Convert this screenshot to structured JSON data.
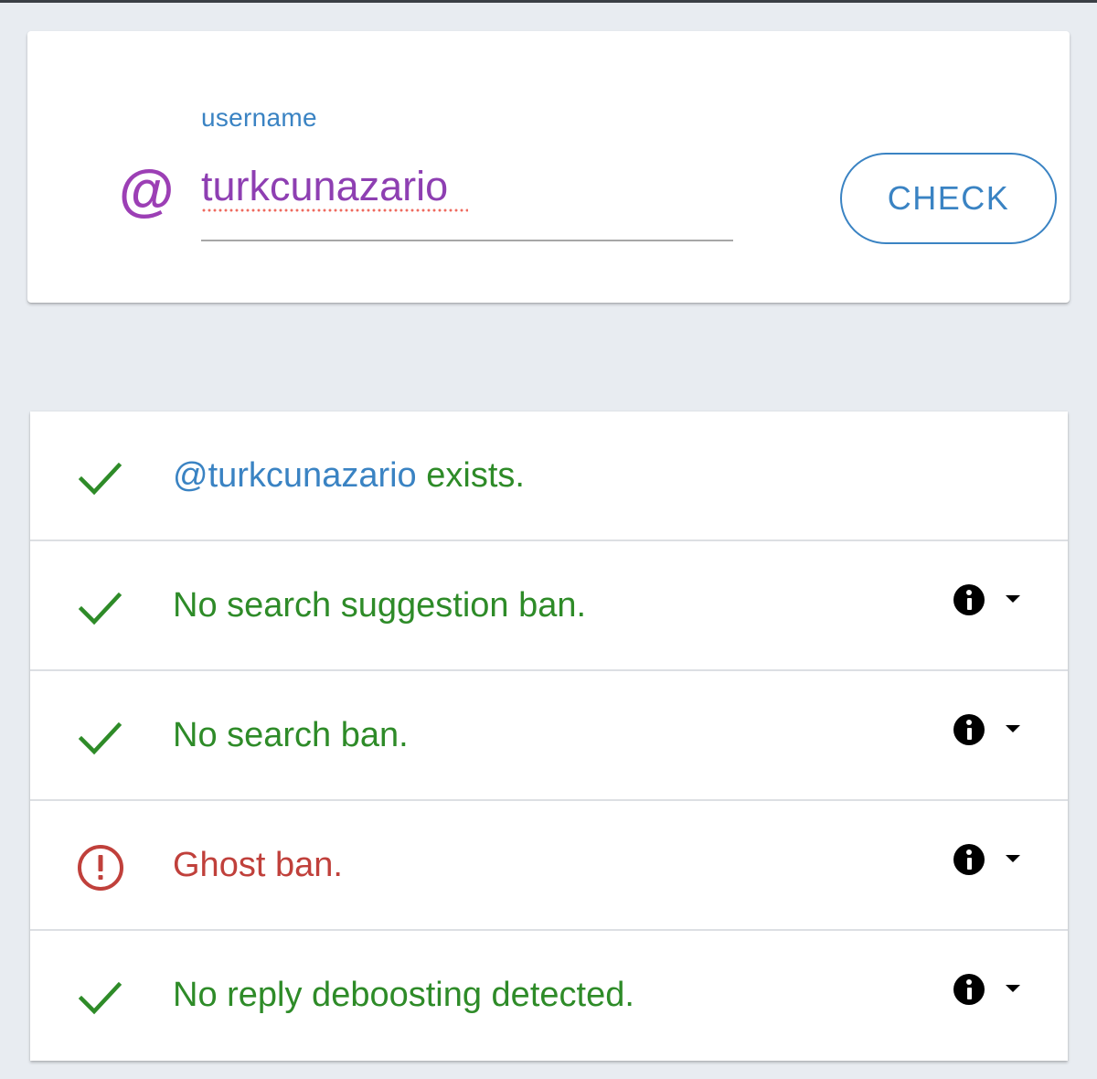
{
  "search": {
    "label": "username",
    "value": "turkcunazario",
    "prefix_icon": "at-icon",
    "check_label": "CHECK",
    "accent_color": "#3a83c3",
    "input_color": "#8e3fb2"
  },
  "results": {
    "exists": {
      "icon": "check-icon",
      "handle": "@turkcunazario",
      "text": " exists.",
      "status": "ok"
    },
    "search_suggestion_ban": {
      "icon": "check-icon",
      "text": "No search suggestion ban.",
      "status": "ok",
      "info_icon": "info-icon",
      "toggle_icon": "caret-down-icon"
    },
    "search_ban": {
      "icon": "check-icon",
      "text": "No search ban.",
      "status": "ok",
      "info_icon": "info-icon",
      "toggle_icon": "caret-down-icon"
    },
    "ghost_ban": {
      "icon": "alert-circle-icon",
      "text": "Ghost ban.",
      "status": "banned",
      "info_icon": "info-icon",
      "toggle_icon": "caret-down-icon"
    },
    "reply_deboosting": {
      "icon": "check-icon",
      "text": "No reply deboosting detected.",
      "status": "ok",
      "info_icon": "info-icon",
      "toggle_icon": "caret-down-icon"
    }
  },
  "colors": {
    "ok": "#2e8b28",
    "banned": "#c0403b",
    "background": "#e8ecf1"
  }
}
